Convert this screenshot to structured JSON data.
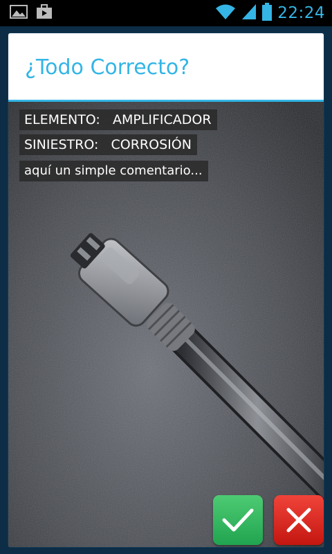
{
  "status_bar": {
    "time": "22:24",
    "icons": [
      "gallery-icon",
      "briefcase-icon",
      "wifi-icon",
      "signal-icon",
      "battery-icon"
    ],
    "accent_color": "#35b5e5"
  },
  "dialog": {
    "title": "¿Todo Correcto?",
    "element_line": "ELEMENTO:   AMPLIFICADOR",
    "incident_line": "SINIESTRO:   CORROSIÓN",
    "comment": "aquí un simple comentario...",
    "photo_subject": "usb-cable-photo",
    "confirm_icon": "checkmark-icon",
    "cancel_icon": "close-icon",
    "confirm_color": "#2eb35a",
    "cancel_color": "#d8241c"
  }
}
